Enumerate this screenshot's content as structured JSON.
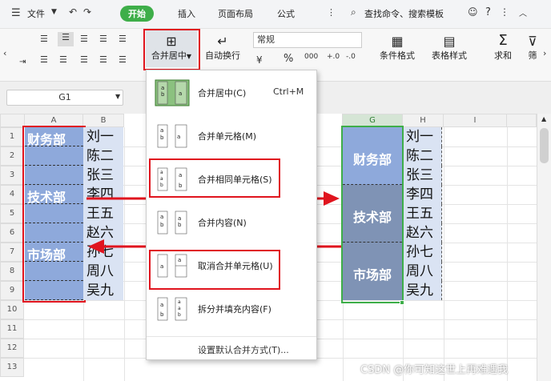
{
  "menu": {
    "file": "文件",
    "tabs": [
      "开始",
      "插入",
      "页面布局",
      "公式"
    ],
    "search": "查找命令、搜索模板"
  },
  "ribbon": {
    "merge_label": "合并居中",
    "wrap_label": "自动换行",
    "number_format": "常规",
    "percent": "%",
    "cond_format": "条件格式",
    "table_style": "表格样式",
    "sum": "求和",
    "filter": "筛"
  },
  "namebox": "G1",
  "columns": [
    "A",
    "B",
    "G",
    "H",
    "I"
  ],
  "rows": [
    "1",
    "2",
    "3",
    "4",
    "5",
    "6",
    "7",
    "8",
    "9",
    "10",
    "11",
    "12",
    "13"
  ],
  "depts": [
    "财务部",
    "技术部",
    "市场部"
  ],
  "names": [
    "刘一",
    "陈二",
    "张三",
    "李四",
    "王五",
    "赵六",
    "孙七",
    "周八",
    "吴九"
  ],
  "dropdown": [
    {
      "label": "合并居中(C)",
      "shortcut": "Ctrl+M"
    },
    {
      "label": "合并单元格(M)",
      "shortcut": ""
    },
    {
      "label": "合并相同单元格(S)",
      "shortcut": ""
    },
    {
      "label": "合并内容(N)",
      "shortcut": ""
    },
    {
      "label": "取消合并单元格(U)",
      "shortcut": ""
    },
    {
      "label": "拆分并填充内容(F)",
      "shortcut": ""
    }
  ],
  "dropdown_footer": "设置默认合并方式(T)...",
  "watermark": "CSDN @你可知这世上再难遇我",
  "colors": {
    "accent": "#3eae49",
    "highlight": "#e0141e",
    "deptFill": "#8ea9db",
    "nameFill": "#dae3f3"
  }
}
